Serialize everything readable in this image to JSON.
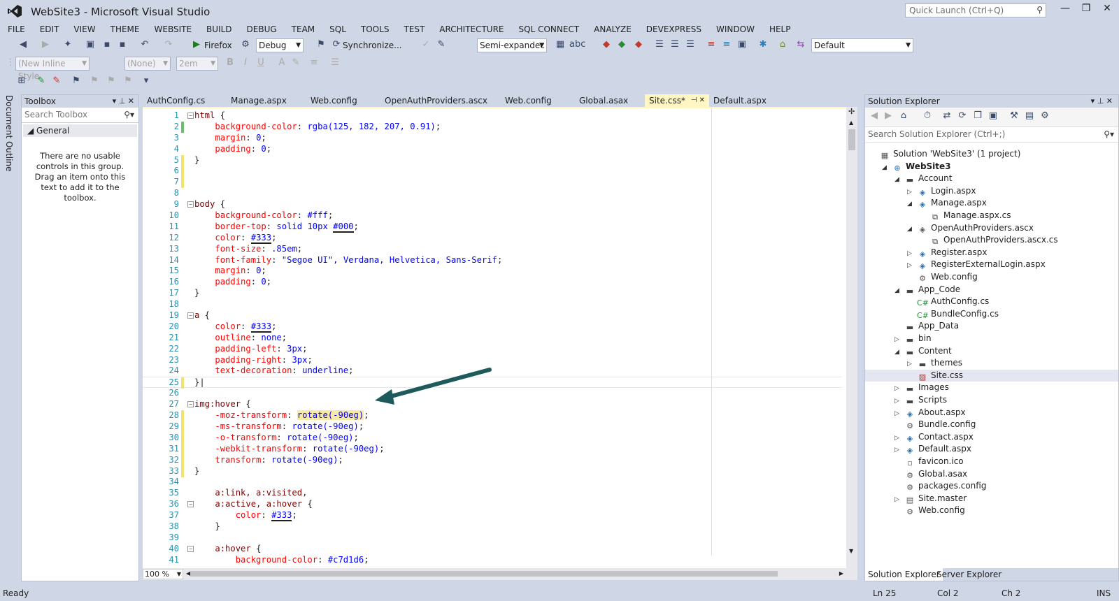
{
  "window": {
    "title": "WebSite3 - Microsoft Visual Studio",
    "quick_launch_placeholder": "Quick Launch (Ctrl+Q)"
  },
  "menu": [
    "FILE",
    "EDIT",
    "VIEW",
    "THEME",
    "WEBSITE",
    "BUILD",
    "DEBUG",
    "TEAM",
    "SQL",
    "TOOLS",
    "TEST",
    "ARCHITECTURE",
    "SQL CONNECT",
    "ANALYZE",
    "DEVEXPRESS",
    "WINDOW",
    "HELP"
  ],
  "toolbar": {
    "browser": "Firefox",
    "config": "Debug",
    "sync_label": "Synchronize...",
    "view_mode": "Semi-expandec",
    "layout": "Default",
    "style": "(New Inline Style",
    "target": "(None)",
    "font_size": "2em"
  },
  "doc_outline": "Document Outline",
  "toolbox": {
    "title": "Toolbox",
    "search": "Search Toolbox",
    "group": "General",
    "empty_text": "There are no usable controls in this group. Drag an item onto this text to add it to the toolbox."
  },
  "tabs": [
    "AuthConfig.cs",
    "Manage.aspx",
    "Web.config",
    "OpenAuthProviders.ascx",
    "Web.config",
    "Global.asax",
    "Site.css*",
    "Default.aspx"
  ],
  "editor": {
    "zoom": "100 %"
  },
  "solution": {
    "title": "Solution Explorer",
    "search": "Search Solution Explorer (Ctrl+;)",
    "bottom_tabs": [
      "Solution Explorer",
      "Server Explorer"
    ],
    "items": [
      "Solution 'WebSite3' (1 project)",
      "WebSite3",
      "Account",
      "Login.aspx",
      "Manage.aspx",
      "Manage.aspx.cs",
      "OpenAuthProviders.ascx",
      "OpenAuthProviders.ascx.cs",
      "Register.aspx",
      "RegisterExternalLogin.aspx",
      "Web.config",
      "App_Code",
      "AuthConfig.cs",
      "BundleConfig.cs",
      "App_Data",
      "bin",
      "Content",
      "themes",
      "Site.css",
      "Images",
      "Scripts",
      "About.aspx",
      "Bundle.config",
      "Contact.aspx",
      "Default.aspx",
      "favicon.ico",
      "Global.asax",
      "packages.config",
      "Site.master",
      "Web.config"
    ]
  },
  "status": {
    "ready": "Ready",
    "ln": "Ln 25",
    "col": "Col 2",
    "ch": "Ch 2",
    "ins": "INS"
  }
}
